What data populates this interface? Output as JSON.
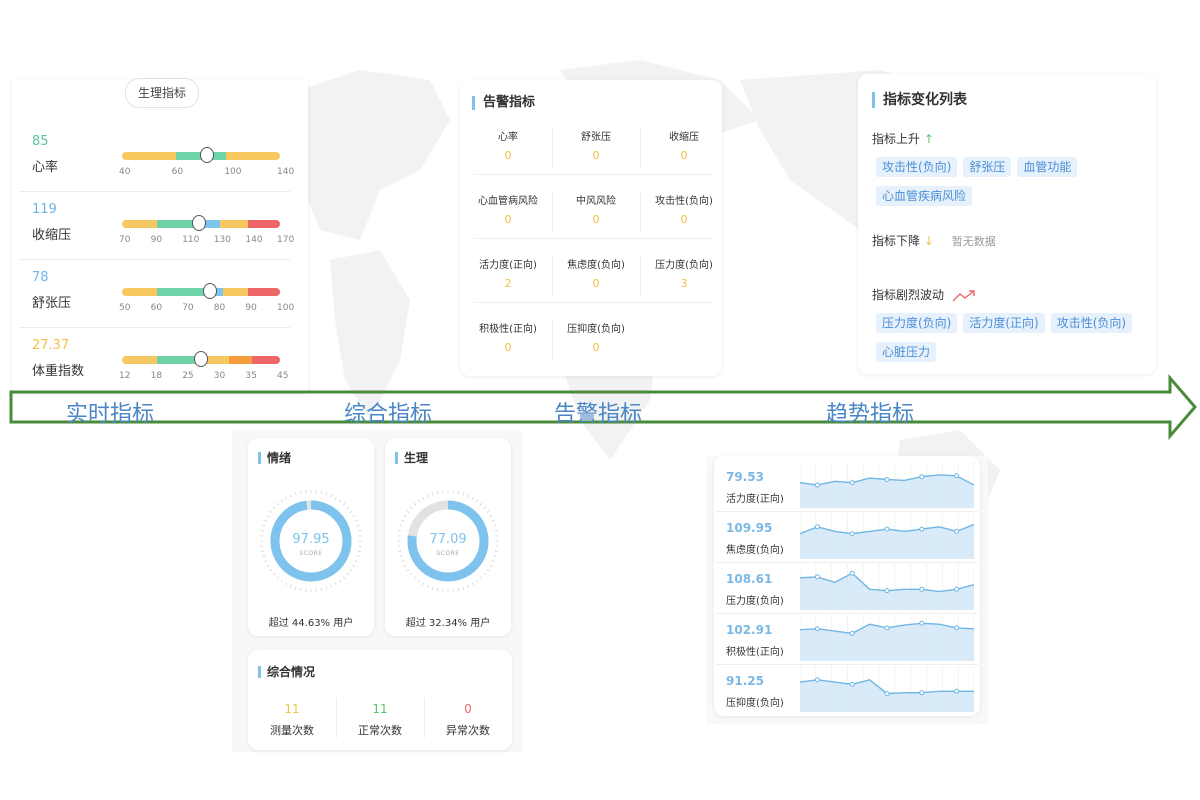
{
  "realtime": {
    "pill": "生理指标",
    "rows": [
      {
        "value": "85",
        "label": "心率",
        "value_color": "#5bc49a",
        "segments": [
          [
            "#f6c85f",
            34
          ],
          [
            "#6ed3a8",
            32
          ],
          [
            "#f6c85f",
            34
          ]
        ],
        "knob": 0.54,
        "ticks": [
          "40",
          "60",
          "100",
          "140"
        ]
      },
      {
        "value": "119",
        "label": "收缩压",
        "value_color": "#6fb6e6",
        "segments": [
          [
            "#f6c85f",
            22
          ],
          [
            "#6ed3a8",
            28
          ],
          [
            "#7ec3ee",
            12
          ],
          [
            "#f6c85f",
            18
          ],
          [
            "#ee6666",
            20
          ]
        ],
        "knob": 0.49,
        "ticks": [
          "70",
          "90",
          "110",
          "130",
          "140",
          "170"
        ]
      },
      {
        "value": "78",
        "label": "舒张压",
        "value_color": "#6fb6e6",
        "segments": [
          [
            "#f6c85f",
            22
          ],
          [
            "#6ed3a8",
            36
          ],
          [
            "#7ec3ee",
            6
          ],
          [
            "#f6c85f",
            16
          ],
          [
            "#ee6666",
            20
          ]
        ],
        "knob": 0.56,
        "ticks": [
          "50",
          "60",
          "70",
          "80",
          "90",
          "100"
        ]
      },
      {
        "value": "27.37",
        "label": "体重指数",
        "value_color": "#f3c24a",
        "segments": [
          [
            "#f6c85f",
            22
          ],
          [
            "#6ed3a8",
            24
          ],
          [
            "#f6c85f",
            22
          ],
          [
            "#f49b3d",
            14
          ],
          [
            "#ee6666",
            18
          ]
        ],
        "knob": 0.5,
        "ticks": [
          "12",
          "18",
          "25",
          "30",
          "35",
          "45"
        ]
      }
    ]
  },
  "alarms": {
    "title": "告警指标",
    "cells": [
      {
        "label": "心率",
        "value": "0"
      },
      {
        "label": "舒张压",
        "value": "0"
      },
      {
        "label": "收缩压",
        "value": "0"
      },
      {
        "label": "心血管病风险",
        "value": "0"
      },
      {
        "label": "中风风险",
        "value": "0"
      },
      {
        "label": "攻击性(负向)",
        "value": "0"
      },
      {
        "label": "活力度(正向)",
        "value": "2"
      },
      {
        "label": "焦虑度(负向)",
        "value": "0"
      },
      {
        "label": "压力度(负向)",
        "value": "3"
      },
      {
        "label": "积极性(正向)",
        "value": "0"
      },
      {
        "label": "压抑度(负向)",
        "value": "0"
      }
    ]
  },
  "trend_list": {
    "title": "指标变化列表",
    "rise": {
      "label": "指标上升",
      "arrow": "↑",
      "tags": [
        "攻击性(负向)",
        "舒张压",
        "血管功能",
        "心血管疾病风险"
      ]
    },
    "fall": {
      "label": "指标下降",
      "arrow": "↓",
      "empty": "暂无数据"
    },
    "fluct": {
      "label": "指标剧烈波动",
      "tags": [
        "压力度(负向)",
        "活力度(正向)",
        "攻击性(负向)",
        "心脏压力"
      ]
    }
  },
  "flow_labels": [
    "实时指标",
    "综合指标",
    "告警指标",
    "趋势指标"
  ],
  "emotion": {
    "title": "情绪",
    "score": "97.95",
    "score_label": "SCORE",
    "percent": 0.9795,
    "footer": "超过 44.63% 用户"
  },
  "physio": {
    "title": "生理",
    "score": "77.09",
    "score_label": "SCORE",
    "percent": 0.7709,
    "footer": "超过 32.34% 用户"
  },
  "summary": {
    "title": "综合情况",
    "cells": [
      {
        "value": "11",
        "label": "测量次数",
        "color": "#f3c24a"
      },
      {
        "value": "11",
        "label": "正常次数",
        "color": "#5bc46a"
      },
      {
        "value": "0",
        "label": "异常次数",
        "color": "#ee6666"
      }
    ]
  },
  "trends": [
    {
      "value": "79.53",
      "label": "活力度(正向)",
      "points": [
        0.45,
        0.5,
        0.42,
        0.45,
        0.35,
        0.38,
        0.4,
        0.32,
        0.28,
        0.3,
        0.5
      ]
    },
    {
      "value": "109.95",
      "label": "焦虑度(负向)",
      "points": [
        0.45,
        0.3,
        0.4,
        0.45,
        0.4,
        0.35,
        0.4,
        0.35,
        0.3,
        0.4,
        0.25
      ]
    },
    {
      "value": "108.61",
      "label": "压力度(负向)",
      "points": [
        0.3,
        0.28,
        0.4,
        0.2,
        0.55,
        0.58,
        0.55,
        0.55,
        0.6,
        0.55,
        0.45
      ]
    },
    {
      "value": "102.91",
      "label": "积极性(正向)",
      "points": [
        0.32,
        0.3,
        0.35,
        0.4,
        0.2,
        0.28,
        0.22,
        0.18,
        0.2,
        0.28,
        0.3
      ]
    },
    {
      "value": "91.25",
      "label": "压抑度(负向)",
      "points": [
        0.35,
        0.3,
        0.35,
        0.4,
        0.3,
        0.6,
        0.58,
        0.58,
        0.55,
        0.55,
        0.55
      ]
    }
  ],
  "colors": {
    "accent": "#7ec3ee",
    "arrow": "#4a8a3a"
  }
}
